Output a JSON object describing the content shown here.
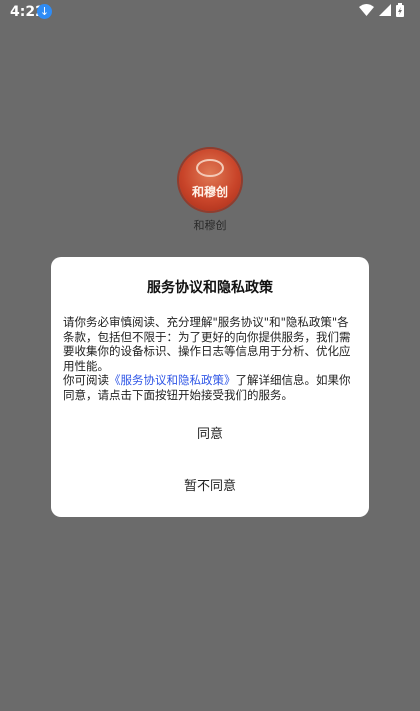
{
  "status_bar": {
    "time": "4:22",
    "download_icon": "download-icon",
    "wifi_icon": "wifi-icon",
    "signal_icon": "signal-icon",
    "battery_icon": "battery-charging-icon"
  },
  "app": {
    "logo_text": "和穆创",
    "name": "和穆创"
  },
  "dialog": {
    "title": "服务协议和隐私政策",
    "paragraph1": "请你务必审慎阅读、充分理解\"服务协议\"和\"隐私政策\"各条款，包括但不限于：为了更好的向你提供服务，我们需要收集你的设备标识、操作日志等信息用于分析、优化应用性能。",
    "paragraph2_prefix": "你可阅读",
    "policy_link": "《服务协议和隐私政策》",
    "paragraph2_suffix": "了解详细信息。如果你同意，请点击下面按钮开始接受我们的服务。",
    "agree_label": "同意",
    "disagree_label": "暂不同意"
  },
  "colors": {
    "overlay": "#6b6b6b",
    "dialog_bg": "#ffffff",
    "link": "#2f56e6",
    "logo": "#c9452a"
  }
}
